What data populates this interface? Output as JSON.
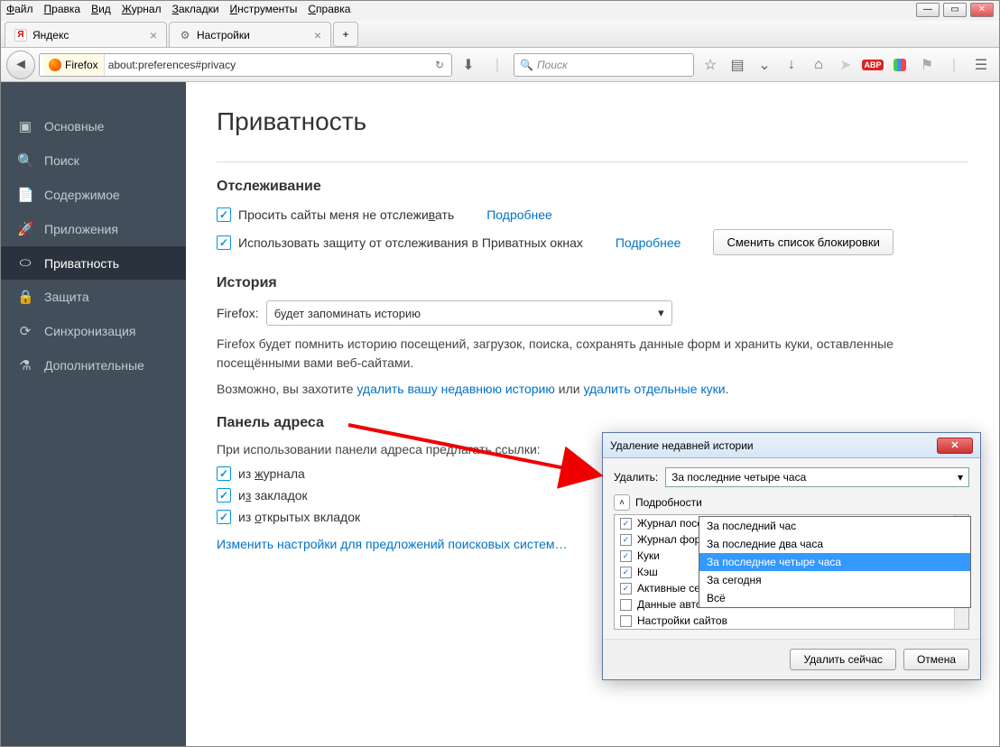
{
  "menubar": [
    "Файл",
    "Правка",
    "Вид",
    "Журнал",
    "Закладки",
    "Инструменты",
    "Справка"
  ],
  "tabs": [
    {
      "label": "Яндекс",
      "favicon": "Y"
    },
    {
      "label": "Настройки",
      "favicon": "gear"
    }
  ],
  "urlbar": {
    "identity": "Firefox",
    "url": "about:preferences#privacy"
  },
  "searchbar": {
    "placeholder": "Поиск"
  },
  "sidebar": {
    "items": [
      {
        "icon": "⬚",
        "label": "Основные"
      },
      {
        "icon": "🔍",
        "label": "Поиск"
      },
      {
        "icon": "📄",
        "label": "Содержимое"
      },
      {
        "icon": "🚀",
        "label": "Приложения"
      },
      {
        "icon": "👓",
        "label": "Приватность"
      },
      {
        "icon": "🔒",
        "label": "Защита"
      },
      {
        "icon": "⟳",
        "label": "Синхронизация"
      },
      {
        "icon": "⚗",
        "label": "Дополнительные"
      }
    ],
    "active_index": 4
  },
  "page": {
    "title": "Приватность",
    "tracking_heading": "Отслеживание",
    "tracking_dnt": "Просить сайты меня не отслеживать",
    "tracking_protect": "Использовать защиту от отслеживания в Приватных окнах",
    "learn_more": "Подробнее",
    "change_blocklist": "Сменить список блокировки",
    "history_heading": "История",
    "history_label": "Firefox:",
    "history_select": "будет запоминать историю",
    "history_desc": "Firefox будет помнить историю посещений, загрузок, поиска, сохранять данные форм и хранить куки, оставленные посещёнными вами веб-сайтами.",
    "maybe_prefix": "Возможно, вы захотите ",
    "clear_history_link": "удалить вашу недавнюю историю",
    "or": " или ",
    "clear_cookies_link": "удалить отдельные куки",
    "addressbar_heading": "Панель адреса",
    "addressbar_desc": "При использовании панели адреса предлагать ссылки:",
    "ab_history": "из журнала",
    "ab_bookmarks": "из закладок",
    "ab_opentabs": "из открытых вкладок",
    "change_search_link": "Изменить настройки для предложений поисковых систем…"
  },
  "dialog": {
    "title": "Удаление недавней истории",
    "range_label": "Удалить:",
    "range_selected": "За последние четыре часа",
    "range_options": [
      "За последний час",
      "За последние два часа",
      "За последние четыре часа",
      "За сегодня",
      "Всё"
    ],
    "range_highlight_index": 2,
    "details_label": "Подробности",
    "items": [
      {
        "checked": true,
        "label": "Журнал посещений и загрузок"
      },
      {
        "checked": true,
        "label": "Журнал форм и поиска"
      },
      {
        "checked": true,
        "label": "Куки"
      },
      {
        "checked": true,
        "label": "Кэш"
      },
      {
        "checked": true,
        "label": "Активные сеансы"
      },
      {
        "checked": false,
        "label": "Данные автономных веб-сайтов"
      },
      {
        "checked": false,
        "label": "Настройки сайтов"
      }
    ],
    "ok": "Удалить сейчас",
    "cancel": "Отмена"
  }
}
